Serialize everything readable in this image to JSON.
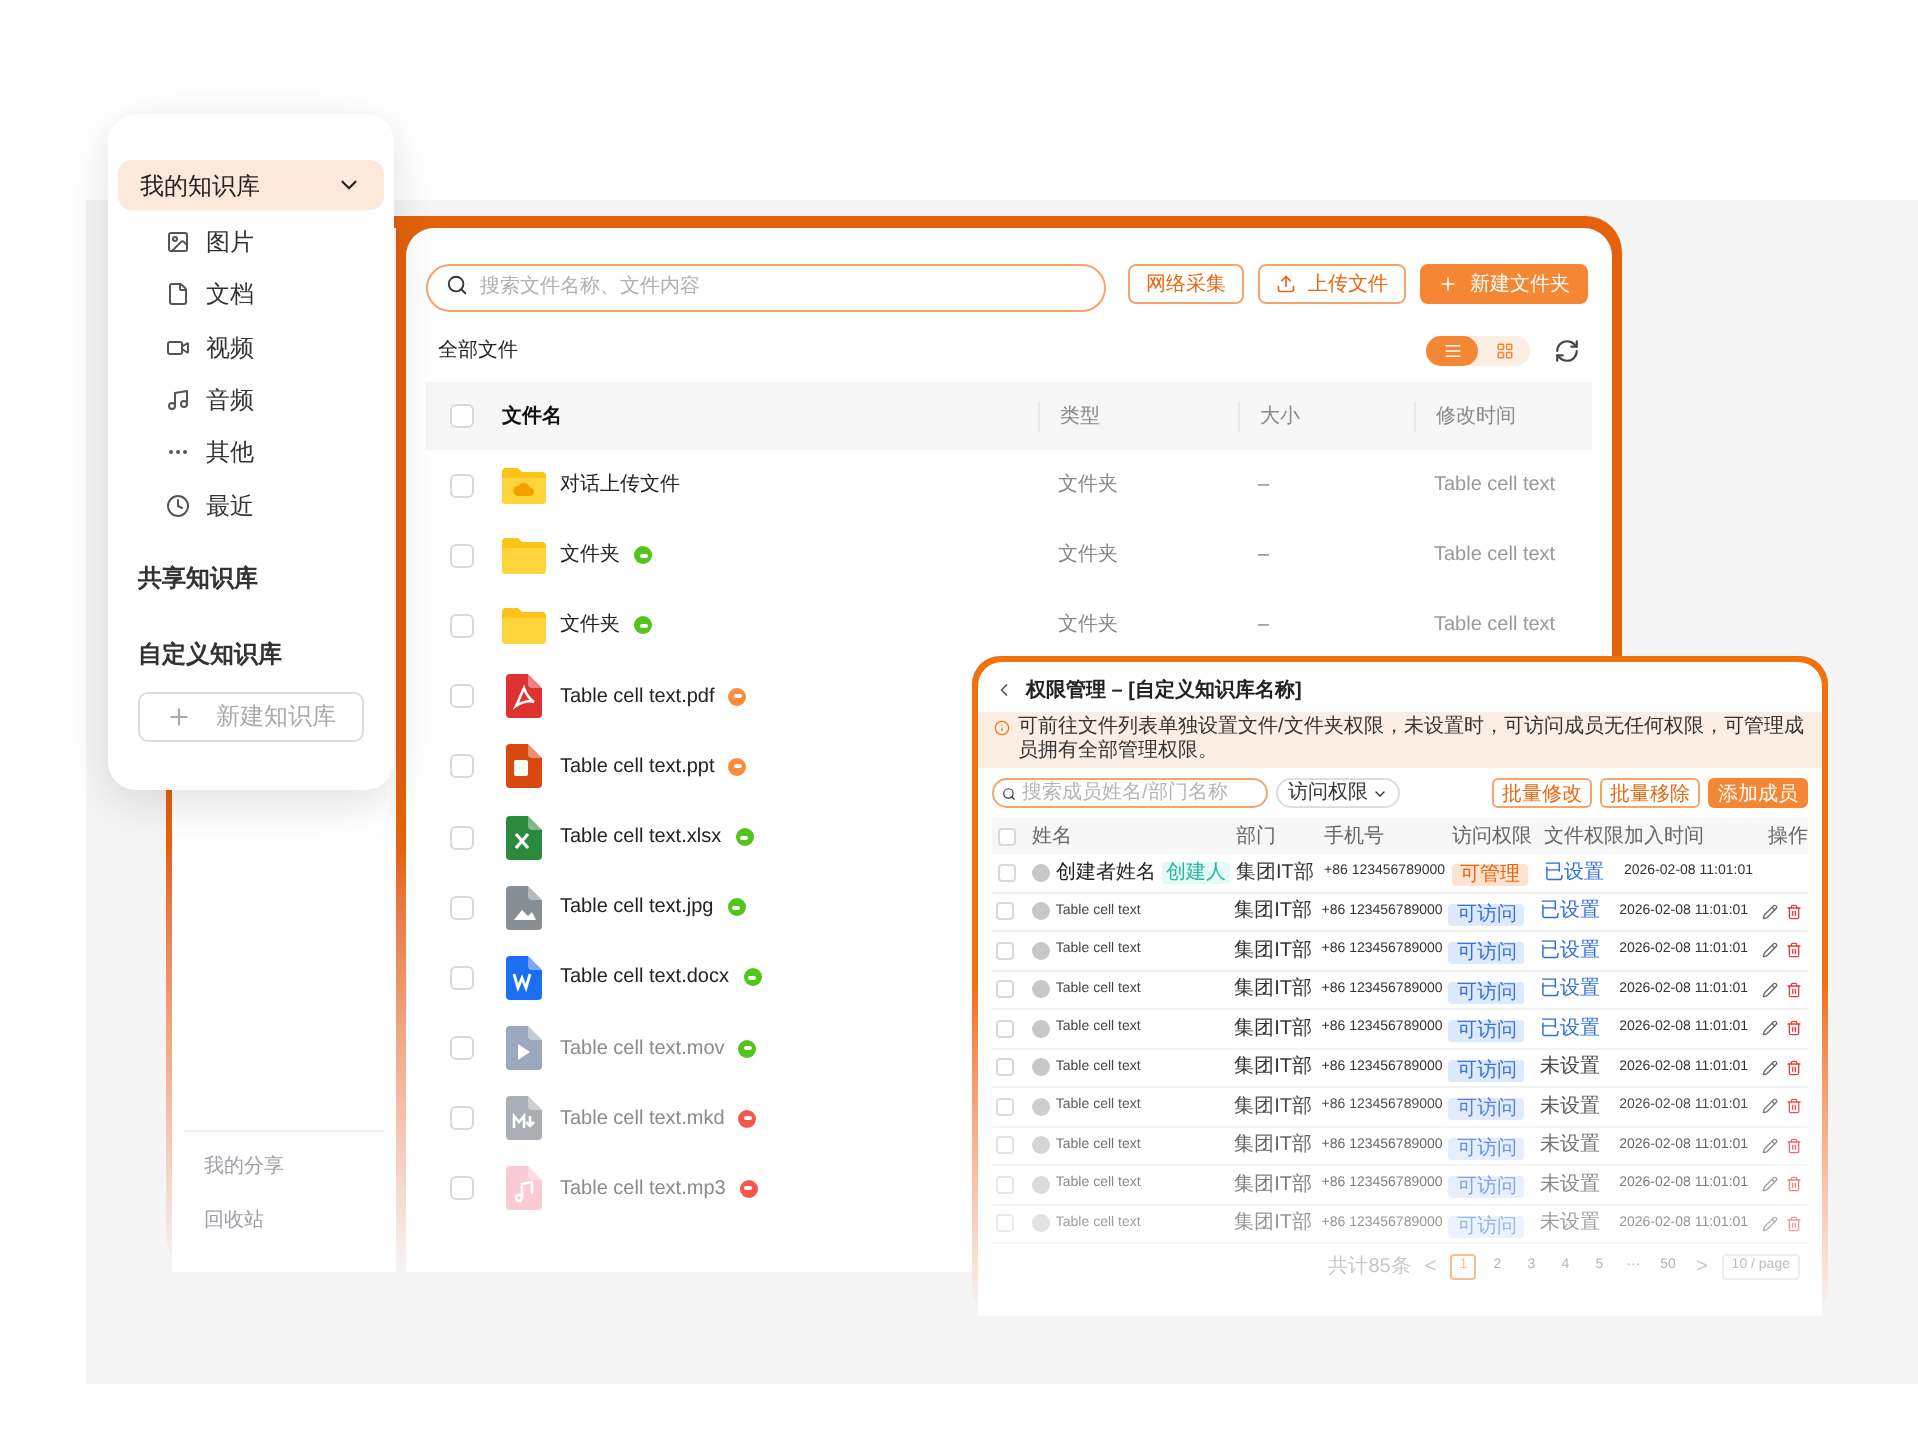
{
  "menu_panel": {
    "my_library": {
      "label": "我的知识库",
      "selected": true,
      "expanded": true,
      "children": [
        {
          "label": "图片",
          "kind": "image"
        },
        {
          "label": "文档",
          "kind": "document"
        },
        {
          "label": "视频",
          "kind": "video"
        },
        {
          "label": "音频",
          "kind": "audio"
        },
        {
          "label": "其他",
          "kind": "other"
        },
        {
          "label": "最近",
          "kind": "recent"
        }
      ]
    },
    "shared_library": "共享知识库",
    "custom_library": "自定义知识库",
    "new_button": "新建知识库"
  },
  "main_sidebar": {
    "items": [
      "我的分享",
      "回收站"
    ]
  },
  "file_panel": {
    "search": {
      "placeholder": "搜索文件名称、文件内容"
    },
    "buttons": [
      {
        "label": "网络采集",
        "kind": "outline"
      },
      {
        "label": "上传文件",
        "kind": "upload"
      },
      {
        "label": "新建文件夹",
        "kind": "primary"
      }
    ],
    "breadcrumb": "全部文件",
    "views": [
      {
        "kind": "list",
        "selected": true
      },
      {
        "kind": "grid",
        "selected": false
      }
    ],
    "table": {
      "header_checked": false,
      "columns": [
        "文件名",
        "类型",
        "大小",
        "修改时间"
      ],
      "rows": [
        {
          "kind": "cloud-folder",
          "name": "对话上传文件",
          "checked": false,
          "type": "文件夹",
          "size": "–",
          "modified": "Table cell text"
        },
        {
          "kind": "folder",
          "name": "文件夹",
          "checked": false,
          "color": "#52c41a",
          "type": "文件夹",
          "size": "–",
          "modified": "Table cell text"
        },
        {
          "kind": "folder",
          "name": "文件夹",
          "checked": false,
          "color": "#52c41a",
          "type": "文件夹",
          "size": "–",
          "modified": "Table cell text"
        },
        {
          "kind": "pdf",
          "name": "Table cell text.pdf",
          "checked": false,
          "color": "#fa8c3c"
        },
        {
          "kind": "ppt",
          "name": "Table cell text.ppt",
          "checked": false,
          "color": "#fa8c3c"
        },
        {
          "kind": "xlsx",
          "name": "Table cell text.xlsx",
          "checked": false,
          "color": "#52c41a"
        },
        {
          "kind": "image",
          "name": "Table cell text.jpg",
          "checked": false,
          "color": "#52c41a"
        },
        {
          "kind": "word",
          "name": "Table cell text.docx",
          "checked": false,
          "color": "#52c41a"
        },
        {
          "kind": "video",
          "name": "Table cell text.mov",
          "checked": false,
          "color": "#52c41a"
        },
        {
          "kind": "markdown",
          "name": "Table cell text.mkd",
          "checked": false,
          "color": "#f5574f"
        },
        {
          "kind": "music",
          "name": "Table cell text.mp3",
          "checked": false,
          "color": "#f5574f"
        }
      ]
    }
  },
  "permission_panel": {
    "title": "权限管理 – [自定义知识库名称]",
    "notice": "可前往文件列表单独设置文件/文件夹权限，未设置时，可访问成员无任何权限，可管理成员拥有全部管理权限。",
    "search": {
      "placeholder": "搜索成员姓名/部门名称"
    },
    "filter": "访问权限",
    "buttons": [
      {
        "label": "批量修改",
        "kind": "outline"
      },
      {
        "label": "批量移除",
        "kind": "outline"
      },
      {
        "label": "添加成员",
        "kind": "primary"
      }
    ],
    "header_checked": false,
    "columns": [
      "姓名",
      "部门",
      "手机号",
      "访问权限",
      "文件权限",
      "加入时间",
      "操作"
    ],
    "rows": [
      {
        "kind": "creator",
        "name": "创建者姓名",
        "badge": "创建人",
        "checked": false,
        "dept": "集团IT部",
        "phone": "+86 123456789000",
        "access": "可管理",
        "access_admin": true,
        "file_permission": "已设置",
        "file_permission_set": true,
        "joined": "2026-02-08 11:01:01"
      },
      {
        "kind": "member",
        "name": "Table cell text",
        "checked": false,
        "dept": "集团IT部",
        "phone": "+86 123456789000",
        "access": "可访问",
        "access_admin": false,
        "file_permission": "已设置",
        "file_permission_set": true,
        "joined": "2026-02-08 11:01:01"
      },
      {
        "kind": "member",
        "name": "Table cell text",
        "checked": false,
        "dept": "集团IT部",
        "phone": "+86 123456789000",
        "access": "可访问",
        "access_admin": false,
        "file_permission": "已设置",
        "file_permission_set": true,
        "joined": "2026-02-08 11:01:01"
      },
      {
        "kind": "member",
        "name": "Table cell text",
        "checked": false,
        "dept": "集团IT部",
        "phone": "+86 123456789000",
        "access": "可访问",
        "access_admin": false,
        "file_permission": "已设置",
        "file_permission_set": true,
        "joined": "2026-02-08 11:01:01"
      },
      {
        "kind": "member",
        "name": "Table cell text",
        "checked": false,
        "dept": "集团IT部",
        "phone": "+86 123456789000",
        "access": "可访问",
        "access_admin": false,
        "file_permission": "已设置",
        "file_permission_set": true,
        "joined": "2026-02-08 11:01:01"
      },
      {
        "kind": "member",
        "name": "Table cell text",
        "checked": false,
        "dept": "集团IT部",
        "phone": "+86 123456789000",
        "access": "可访问",
        "access_admin": false,
        "file_permission": "未设置",
        "file_permission_set": false,
        "joined": "2026-02-08 11:01:01"
      },
      {
        "kind": "member",
        "name": "Table cell text",
        "checked": false,
        "dept": "集团IT部",
        "phone": "+86 123456789000",
        "access": "可访问",
        "access_admin": false,
        "file_permission": "未设置",
        "file_permission_set": false,
        "joined": "2026-02-08 11:01:01"
      },
      {
        "kind": "member",
        "name": "Table cell text",
        "checked": false,
        "dept": "集团IT部",
        "phone": "+86 123456789000",
        "access": "可访问",
        "access_admin": false,
        "file_permission": "未设置",
        "file_permission_set": false,
        "joined": "2026-02-08 11:01:01"
      },
      {
        "kind": "member",
        "name": "Table cell text",
        "checked": false,
        "dept": "集团IT部",
        "phone": "+86 123456789000",
        "access": "可访问",
        "access_admin": false,
        "file_permission": "未设置",
        "file_permission_set": false,
        "joined": "2026-02-08 11:01:01"
      },
      {
        "kind": "member",
        "name": "Table cell text",
        "checked": false,
        "dept": "集团IT部",
        "phone": "+86 123456789000",
        "access": "可访问",
        "access_admin": false,
        "file_permission": "未设置",
        "file_permission_set": false,
        "joined": "2026-02-08 11:01:01"
      }
    ],
    "pagination": {
      "total": "共计85条",
      "prev": "<",
      "pages": [
        {
          "label": "1",
          "selected": true
        },
        {
          "label": "2",
          "selected": false
        },
        {
          "label": "3",
          "selected": false
        },
        {
          "label": "4",
          "selected": false
        },
        {
          "label": "5",
          "selected": false
        },
        {
          "label": "···",
          "selected": false
        },
        {
          "label": "50",
          "selected": false
        }
      ],
      "next": ">",
      "page_size": "10 / page"
    }
  }
}
